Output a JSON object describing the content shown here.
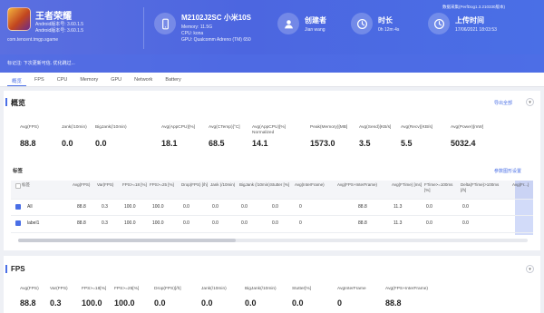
{
  "app": {
    "name": "王者荣耀",
    "meta": [
      "Android版本号: 3.60.1.5",
      "Android版本号: 3.60.1.5"
    ],
    "package": "com.tencent.tmgp.sgame",
    "verify_text": "标记注: 下次更新可信. 优化跳过..."
  },
  "version_text": "数据采集(PerfDog1.3.210330版本)",
  "cards": {
    "device": {
      "title": "M2102J2SC 小米10S",
      "lines": [
        "Memory: 11.5G",
        "CPU: kona",
        "GPU: Qualcomm Adreno (TM) 650"
      ]
    },
    "creator": {
      "title": "创建者",
      "sub": "Jian wang"
    },
    "duration": {
      "title": "时长",
      "sub": "0h 12m 4s"
    },
    "upload": {
      "title": "上传时间",
      "sub": "17/06/2021 18:03:53"
    }
  },
  "tabs": [
    "概览",
    "FPS",
    "CPU",
    "Memory",
    "GPU",
    "Network",
    "Battery"
  ],
  "overview": {
    "title": "概览",
    "action": "导出全部",
    "metrics": [
      {
        "label": "Avg(FPS)",
        "value": "88.8"
      },
      {
        "label": "Jank(/10min)",
        "value": "0.0"
      },
      {
        "label": "BigJank(/10min)",
        "value": "0.0"
      },
      {
        "label": "Avg(AppCPU)[%]",
        "value": "18.1"
      },
      {
        "label": "Avg(CTemp)[°C]",
        "value": "68.5"
      },
      {
        "label": "Avg(AppCPU)[%] Normalized",
        "value": "14.1"
      },
      {
        "label": "Peak(Memory)[MB]",
        "value": "1573.0"
      },
      {
        "label": "Avg(Send)[KB/s]",
        "value": "3.5"
      },
      {
        "label": "Avg(Recv)[KB/s]",
        "value": "5.5"
      },
      {
        "label": "Avg(Power)[mW]",
        "value": "5032.4"
      }
    ],
    "table": {
      "title": "标签",
      "action": "参数图形设置",
      "headers": [
        "标签",
        "Avg(FPS)",
        "Var(FPS)",
        "FPS>=18 [%]",
        "FPS>=25 [%]",
        "Drop(FPS) [/h]",
        "Jank (/10min)",
        "BigJank (/10min)",
        "Stutter [%]",
        "Avg(InterFrame)",
        "Avg(FPS+InterFrame)",
        "Avg(FTime) [ms]",
        "FTime>=100ms [%]",
        "Delta(FTime)>100ms [/h]",
        "Avg(Fr...)"
      ],
      "rows": [
        {
          "label": "All",
          "values": [
            "88.8",
            "0.3",
            "100.0",
            "100.0",
            "0.0",
            "0.0",
            "0.0",
            "0.0",
            "0",
            "88.8",
            "11.3",
            "0.0",
            "0.0"
          ]
        },
        {
          "label": "label1",
          "values": [
            "88.8",
            "0.3",
            "100.0",
            "100.0",
            "0.0",
            "0.0",
            "0.0",
            "0.0",
            "0",
            "88.8",
            "11.3",
            "0.0",
            "0.0"
          ]
        }
      ]
    }
  },
  "fps": {
    "title": "FPS",
    "metrics": [
      {
        "label": "Avg(FPS)",
        "value": "88.8"
      },
      {
        "label": "Var(FPS)",
        "value": "0.3"
      },
      {
        "label": "FPS>=18[%]",
        "value": "100.0"
      },
      {
        "label": "FPS>=25[%]",
        "value": "100.0"
      },
      {
        "label": "Drop(FPS)[/h]",
        "value": "0.0"
      },
      {
        "label": "Jank(/10min)",
        "value": "0.0"
      },
      {
        "label": "BigJank(/10min)",
        "value": "0.0"
      },
      {
        "label": "Stutter[%]",
        "value": "0.0"
      },
      {
        "label": "AvgInterFrame",
        "value": "0"
      },
      {
        "label": "Avg(FPS+InterFrame)",
        "value": "88.8"
      }
    ]
  },
  "colors": {
    "accent": "#4a6fe6",
    "header": "#5b6fe0"
  }
}
